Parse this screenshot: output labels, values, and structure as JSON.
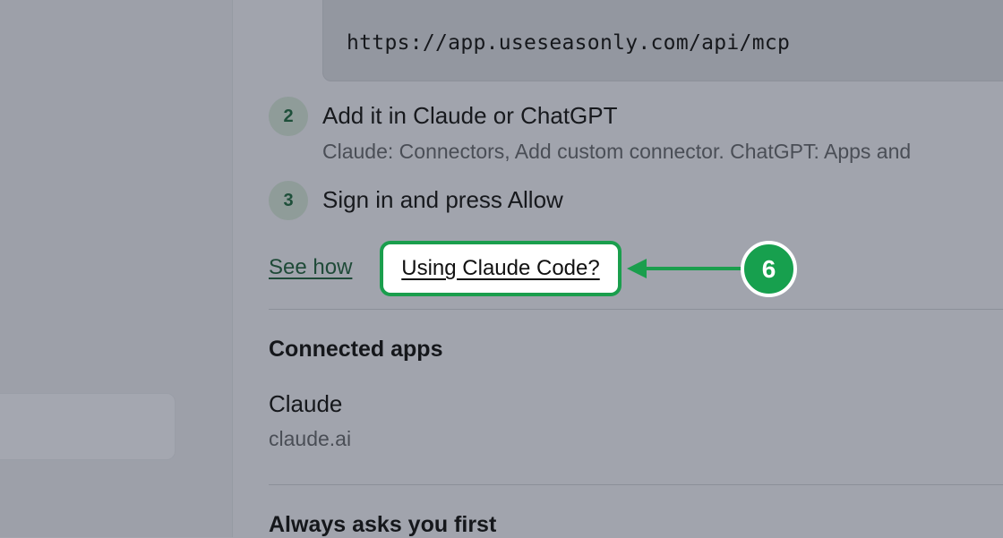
{
  "mcp": {
    "url": "https://app.useseasonly.com/api/mcp"
  },
  "steps": [
    {
      "number": "2",
      "title": "Add it in Claude or ChatGPT",
      "description": "Claude: Connectors, Add custom connector. ChatGPT: Apps and"
    },
    {
      "number": "3",
      "title": "Sign in and press Allow",
      "description": ""
    }
  ],
  "links": {
    "see_how": "See how",
    "using_claude_code": "Using Claude Code?"
  },
  "annotation": {
    "step_badge": "6",
    "color": "#1a9e4d"
  },
  "connected_apps": {
    "heading": "Connected apps",
    "apps": [
      {
        "name": "Claude",
        "domain": "claude.ai"
      }
    ]
  },
  "next_section": {
    "heading": "Always asks you first"
  }
}
